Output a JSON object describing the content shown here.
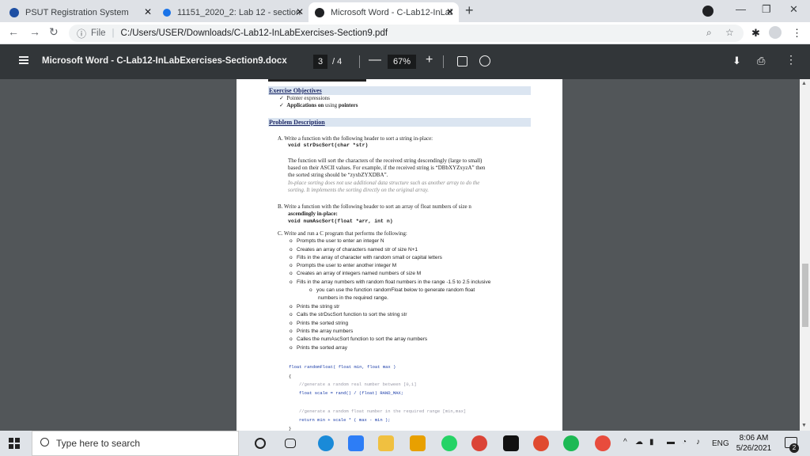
{
  "browser": {
    "tabs": [
      {
        "label": "PSUT Registration System"
      },
      {
        "label": "11151_2020_2: Lab 12 - section 9"
      },
      {
        "label": "Microsoft Word - C-Lab12-InLab"
      }
    ],
    "address": {
      "file_label": "File",
      "path": "C:/Users/USER/Downloads/C-Lab12-InLabExercises-Section9.pdf"
    }
  },
  "pdf_toolbar": {
    "title": "Microsoft Word - C-Lab12-InLabExercises-Section9.docx",
    "current_page": "3",
    "total_pages": "/ 4",
    "zoom": "67%"
  },
  "document": {
    "objectives": {
      "heading": "Exercise Objectives",
      "items": [
        "Pointer expressions",
        "Applications on using pointers"
      ],
      "item2_prefix": "Applications on",
      "item2_mid": "using",
      "item2_suffix": "pointers"
    },
    "problem": {
      "heading": "Problem Description",
      "a_intro": "A.  Write a function with the following header to sort a string in-place:",
      "a_code": "void strDscSort(char *str)",
      "a_p1_l1": "The function will sort the characters of the received string descendingly (large to small)",
      "a_p1_l2": "based on their ASCII values. For example, if the received string is “DBbXYZxyzA” then",
      "a_p1_l3": "the sorted string should be “zyxbZYXDBA”.",
      "a_p2_l1": "In-place sorting does not use additional data structure such as another array to do the",
      "a_p2_l2": "sorting. It implements the sorting directly on the original array.",
      "b_l1": "B.  Write a function with the following header to sort an array of float numbers of size n",
      "b_l2": "ascendingly in-place:",
      "b_code": "void numAscSort(float   *arr, int n)",
      "c_intro": "C.  Write and run a C program that performs the following:",
      "c_items": [
        "Prompts the user to enter an integer N",
        "Creates an array of characters  named str of size N+1",
        "Fills in the array of character with random small or capital letters",
        "Prompts the user to enter another  integer M",
        "Creates an array of integers  named numbers of size M",
        "Fills in the array numbers with random float numbers in the range -1.5 to 2.5 inclusive"
      ],
      "c_sub_l1": "you  can  use  the  function  randomFloat  below  to  generate  random  float",
      "c_sub_l2": "numbers in the required range.",
      "c_items2": [
        "Prints the string str",
        "Calls the strDscSort function to sort the string str",
        "Prints the sorted string",
        "Prints the array numbers",
        "Calles the numAscSort function to sort the array numbers",
        "Prints the sorted array"
      ]
    },
    "code_listing": [
      "float randomFloat( float min, float max )",
      "{",
      "//generate a random real number between [0,1]",
      "float scale = rand() / (float) RAND_MAX;",
      "//generate a random float number in the required range [min,max]",
      "return min + scale * ( max - min );",
      "}"
    ]
  },
  "taskbar": {
    "search_placeholder": "Type here to search",
    "language": "ENG",
    "time": "8:06 AM",
    "date": "5/26/2021",
    "notification_count": "2"
  }
}
